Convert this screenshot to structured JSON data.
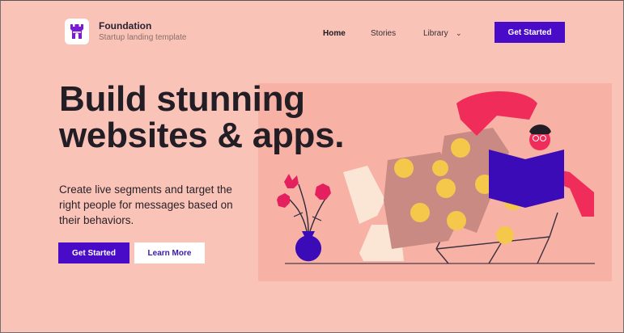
{
  "brand": {
    "name": "Foundation",
    "tagline": "Startup landing template",
    "logo_icon": "castle-icon"
  },
  "nav": {
    "items": [
      {
        "label": "Home",
        "active": true
      },
      {
        "label": "Stories",
        "active": false
      },
      {
        "label": "Library",
        "active": false,
        "has_dropdown": true
      }
    ],
    "cta_label": "Get Started"
  },
  "hero": {
    "title_line1": "Build stunning",
    "title_line2": "websites & apps.",
    "subtitle": "Create live segments and target the right people for messages based on their behaviors.",
    "primary_label": "Get Started",
    "secondary_label": "Learn More",
    "illustration": "person-reading-in-chair-illustration"
  },
  "colors": {
    "background": "#f9c3b8",
    "illustration_panel": "#f7b1a5",
    "accent": "#4a0bc9",
    "heading": "#231e25"
  }
}
